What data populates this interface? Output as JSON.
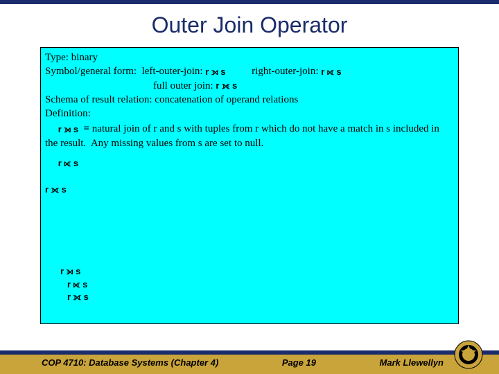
{
  "title": "Outer Join Operator",
  "body": {
    "type_line": "Type: binary",
    "symbol_line_prefix": "Symbol/general form:  ",
    "left_label": "left-outer-join:",
    "left_sym": "r ⟕ s",
    "right_label": "right-outer-join:",
    "right_sym": "r ⟖ s",
    "full_label": "full outer join:",
    "full_sym": "r ⟗ s",
    "schema_line": "Schema of result relation: concatenation of operand relations",
    "definition_label": "Definition:",
    "def_sym": "r ⟕ s",
    "def_eq": "≡",
    "def_text": "natural join of r and s with tuples from r which do not have a match in s included in the result.  Any missing values from s are set to null.",
    "iso_sym1": "r ⟖ s",
    "iso_sym2": "r ⟗ s",
    "bottom_sym1": "r ⟕ s",
    "bottom_sym2": "r ⟖ s",
    "bottom_sym3": "r ⟗ s"
  },
  "footer": {
    "left": "COP 4710: Database Systems  (Chapter 4)",
    "center": "Page 19",
    "right": "Mark Llewellyn"
  }
}
